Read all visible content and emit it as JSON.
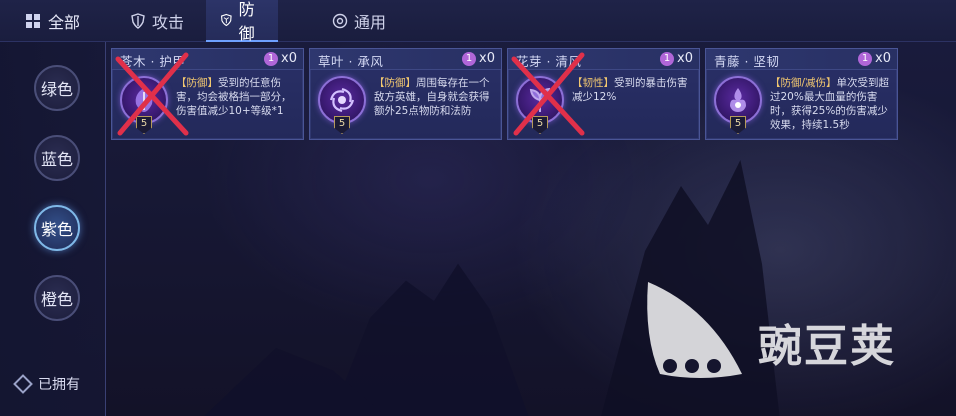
{
  "nav": {
    "all_label": "全部",
    "tabs": [
      {
        "label": "攻击",
        "icon": "sword-shield-icon"
      },
      {
        "label": "防御",
        "icon": "shield-icon",
        "active": true
      },
      {
        "label": "通用",
        "icon": "target-circle-icon"
      }
    ]
  },
  "sidebar": {
    "colors": [
      {
        "label": "绿色"
      },
      {
        "label": "蓝色"
      },
      {
        "label": "紫色",
        "active": true
      },
      {
        "label": "橙色"
      }
    ],
    "owned_label": "已拥有"
  },
  "cards": [
    {
      "name": "苍木 · 护甲",
      "qty_badge": "1",
      "qty": "x0",
      "level": "5",
      "tag": "【防御】",
      "desc": "受到的任意伤害，均会被格挡一部分，伤害值减少10+等级*1",
      "crossed": true,
      "icon": "leaf-armor-icon"
    },
    {
      "name": "草叶 · 承风",
      "qty_badge": "1",
      "qty": "x0",
      "level": "5",
      "tag": "【防御】",
      "desc": "周围每存在一个敌方英雄，自身就会获得额外25点物防和法防",
      "crossed": false,
      "icon": "swirl-icon"
    },
    {
      "name": "花芽 · 清风",
      "qty_badge": "1",
      "qty": "x0",
      "level": "5",
      "tag": "【韧性】",
      "desc": "受到的暴击伤害减少12%",
      "crossed": true,
      "icon": "sprout-icon"
    },
    {
      "name": "青藤 · 坚韧",
      "qty_badge": "1",
      "qty": "x0",
      "level": "5",
      "tag": "【防御/减伤】",
      "desc": "单次受到超过20%最大血量的伤害时，获得25%的伤害减少效果，持续1.5秒",
      "crossed": false,
      "icon": "vine-flame-icon"
    }
  ],
  "watermark": {
    "text": "豌豆荚"
  },
  "colors": {
    "accent": "#6ea0ff",
    "tag": "#f1c770",
    "cross": "#e0304a",
    "badge": "#b066d8"
  }
}
